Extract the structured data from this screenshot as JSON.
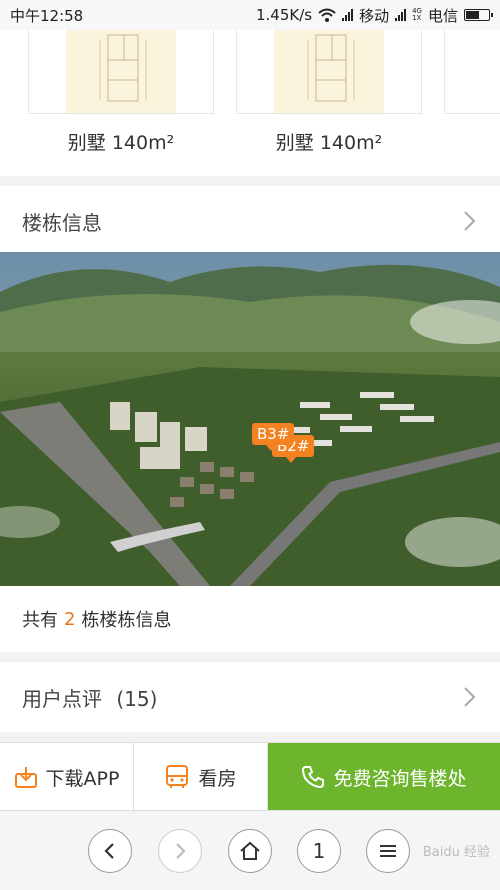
{
  "status_bar": {
    "time": "中午12:58",
    "speed": "1.45K/s",
    "carrier1": "移动",
    "carrier2": "电信",
    "net_badge_top": "4G",
    "net_badge_bottom": "1X"
  },
  "floor_plans": [
    {
      "label": "别墅 140m²"
    },
    {
      "label": "别墅 140m²"
    }
  ],
  "building_section": {
    "title": "楼栋信息",
    "tags": [
      "B3#",
      "B2#"
    ],
    "count_prefix": "共有",
    "count": "2",
    "count_suffix": "栋楼栋信息"
  },
  "reviews_section": {
    "title": "用户点评",
    "count": "(15)"
  },
  "action_bar": {
    "download_label": "下载APP",
    "view_label": "看房",
    "consult_label": "免费咨询售楼处"
  },
  "browser_nav": {
    "tab_count": "1",
    "watermark": "Baidu 经验"
  },
  "colors": {
    "accent_orange": "#f58220",
    "consult_green": "#6cb52d",
    "count_orange": "#e8731c"
  }
}
